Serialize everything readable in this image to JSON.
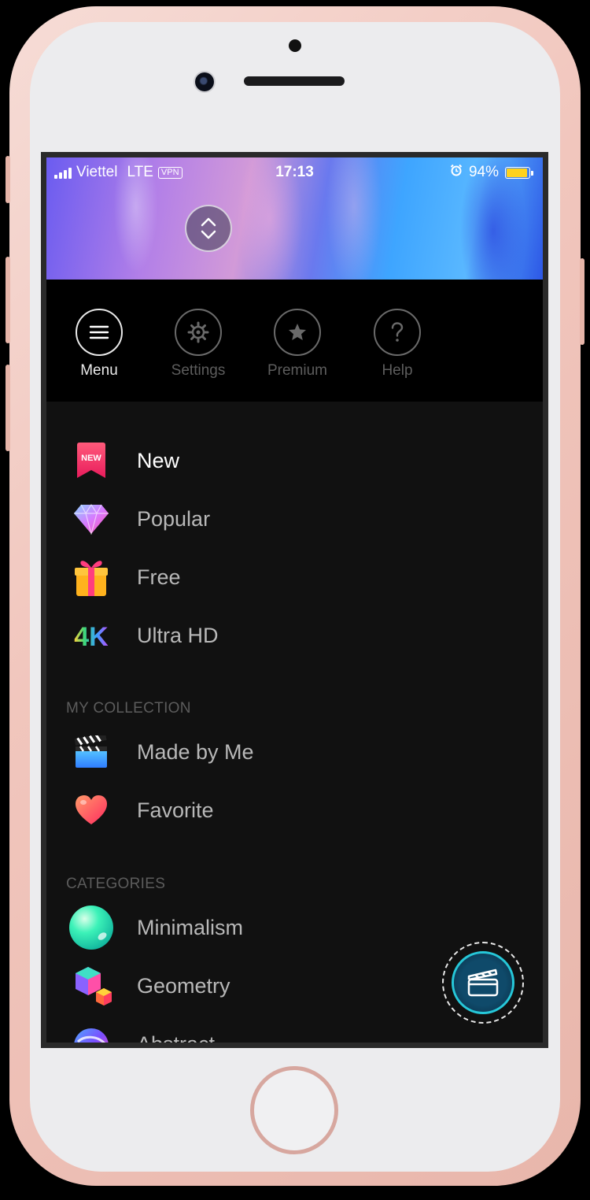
{
  "status_bar": {
    "carrier": "Viettel",
    "network": "LTE",
    "vpn": "VPN",
    "time": "17:13",
    "battery": "94%",
    "battery_level": 0.94
  },
  "topbar": {
    "items": [
      {
        "label": "Menu",
        "icon": "hamburger-icon",
        "active": true
      },
      {
        "label": "Settings",
        "icon": "gear-icon",
        "active": false
      },
      {
        "label": "Premium",
        "icon": "star-icon",
        "active": false
      },
      {
        "label": "Help",
        "icon": "question-icon",
        "active": false
      }
    ]
  },
  "menu": {
    "items": [
      {
        "label": "New",
        "icon": "new-ribbon-icon",
        "active": true
      },
      {
        "label": "Popular",
        "icon": "diamond-icon"
      },
      {
        "label": "Free",
        "icon": "gift-icon"
      },
      {
        "label": "Ultra HD",
        "icon": "4k-icon"
      }
    ],
    "new_badge": "NEW",
    "fourk_badge": "4K"
  },
  "collection": {
    "header": "MY COLLECTION",
    "items": [
      {
        "label": "Made by Me",
        "icon": "clapperboard-icon"
      },
      {
        "label": "Favorite",
        "icon": "heart-icon"
      }
    ]
  },
  "categories": {
    "header": "CATEGORIES",
    "items": [
      {
        "label": "Minimalism",
        "icon": "sphere-icon"
      },
      {
        "label": "Geometry",
        "icon": "cubes-icon"
      },
      {
        "label": "Abstract",
        "icon": "abstract-icon"
      }
    ]
  },
  "colors": {
    "accent_teal": "#26c7d8",
    "background": "#111111",
    "battery": "#ffd21d"
  }
}
